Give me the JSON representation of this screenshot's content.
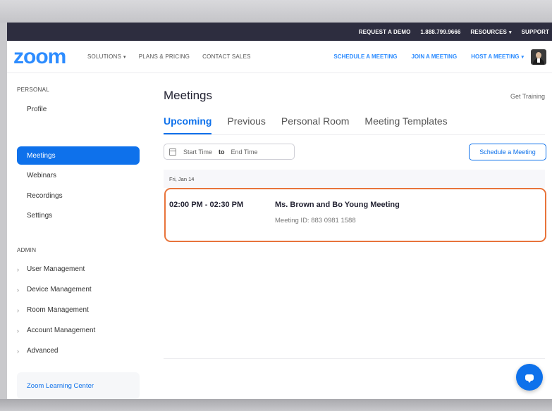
{
  "topbar": {
    "request_demo": "REQUEST A DEMO",
    "phone": "1.888.799.9666",
    "resources": "RESOURCES",
    "support": "SUPPORT"
  },
  "navbar": {
    "logo": "zoom",
    "solutions": "SOLUTIONS",
    "plans": "PLANS & PRICING",
    "contact": "CONTACT SALES",
    "schedule": "SCHEDULE A MEETING",
    "join": "JOIN A MEETING",
    "host": "HOST A MEETING"
  },
  "sidebar": {
    "personal_label": "PERSONAL",
    "items": [
      {
        "label": "Profile"
      },
      {
        "label": "Meetings",
        "active": true
      },
      {
        "label": "Webinars"
      },
      {
        "label": "Recordings"
      },
      {
        "label": "Settings"
      }
    ],
    "admin_label": "ADMIN",
    "admin_items": [
      {
        "label": "User Management"
      },
      {
        "label": "Device Management"
      },
      {
        "label": "Room Management"
      },
      {
        "label": "Account Management"
      },
      {
        "label": "Advanced"
      }
    ],
    "learning_center": "Zoom Learning Center"
  },
  "main": {
    "title": "Meetings",
    "get_training": "Get Training",
    "tabs": [
      {
        "label": "Upcoming",
        "active": true
      },
      {
        "label": "Previous"
      },
      {
        "label": "Personal Room"
      },
      {
        "label": "Meeting Templates"
      }
    ],
    "date_range": {
      "start_placeholder": "Start Time",
      "to": "to",
      "end_placeholder": "End Time"
    },
    "schedule_button": "Schedule a Meeting",
    "date_header": "Fri, Jan 14",
    "meeting": {
      "time": "02:00 PM - 02:30 PM",
      "title": "Ms. Brown and Bo Young Meeting",
      "meeting_id": "Meeting ID: 883 0981 1588"
    }
  },
  "colors": {
    "brand": "#2d8cff",
    "active_blue": "#0e71eb",
    "topbar": "#2d2d3f",
    "highlight": "#e8743b"
  }
}
